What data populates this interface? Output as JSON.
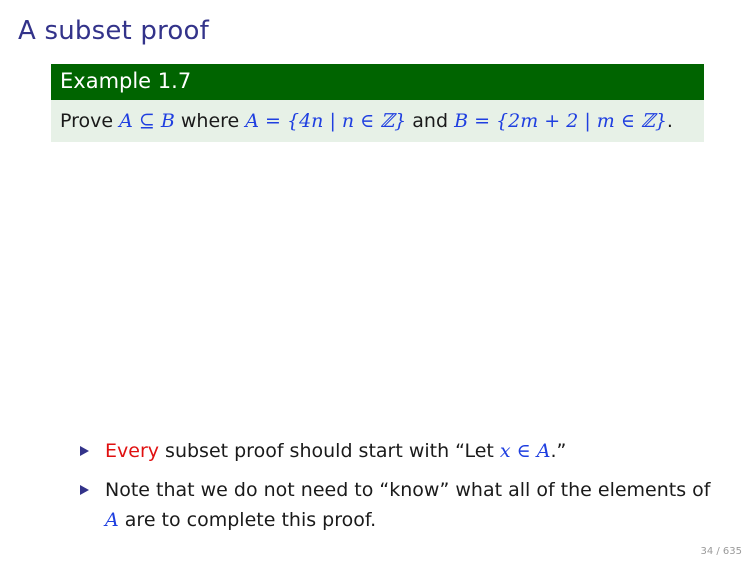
{
  "slide": {
    "title": "A subset proof",
    "page_number": "34 / 635"
  },
  "example": {
    "header": "Example 1.7",
    "prove": "Prove",
    "subset_expr": "A ⊆ B",
    "where": "where",
    "set_a_expr": "A = {4n | n ∈ ℤ}",
    "and": "and",
    "set_b_expr": "B = {2m + 2 | m ∈ ℤ}",
    "period": "."
  },
  "bullets": [
    {
      "alert": "Every",
      "text_before": "subset proof should start with “Let",
      "math": "x ∈ A",
      "text_after": ".”"
    },
    {
      "text_before": "Note that we do not need to “know” what all of the elements of",
      "math": "A",
      "text_after": "are to complete this proof."
    }
  ],
  "colors": {
    "title": "#33338a",
    "header_bg": "#006400",
    "body_bg": "#e7f1e7",
    "math": "#1f3fe0",
    "alert": "#e01010"
  }
}
